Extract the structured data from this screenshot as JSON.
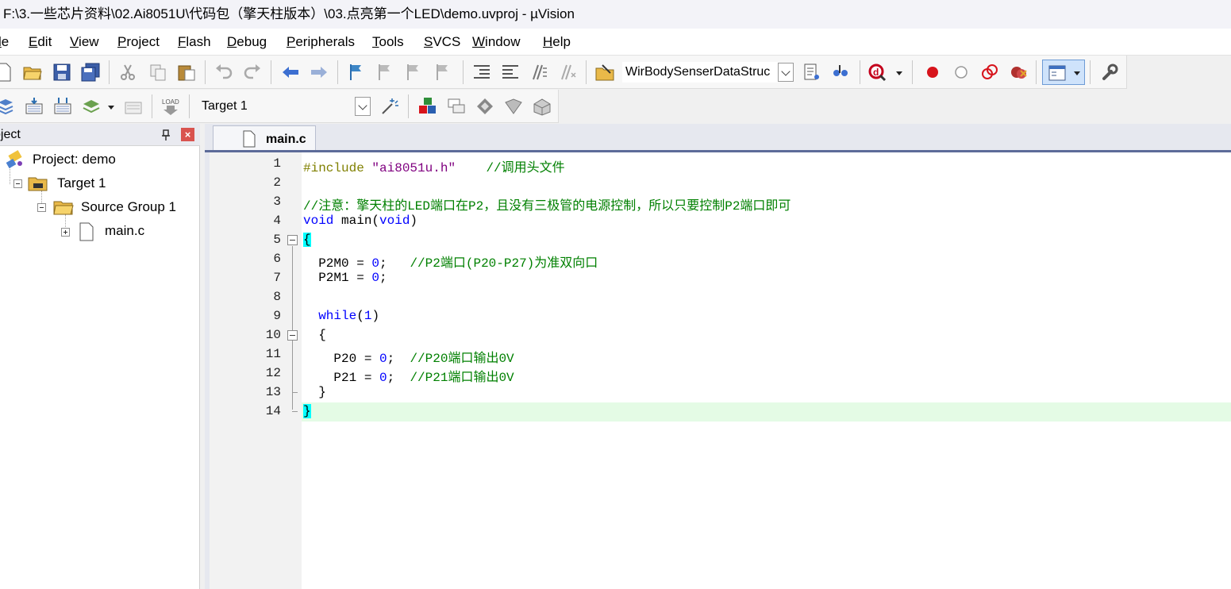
{
  "window": {
    "title": "F:\\3.一些芯片资料\\02.Ai8051U\\代码包（擎天柱版本）\\03.点亮第一个LED\\demo.uvproj - µVision"
  },
  "menu": {
    "file": "le",
    "edit": "Edit",
    "view": "View",
    "project": "Project",
    "flash": "Flash",
    "debug": "Debug",
    "peripherals": "Peripherals",
    "tools": "Tools",
    "svcs": "SVCS",
    "window": "Window",
    "help": "Help"
  },
  "toolbar": {
    "find_combo_value": "WirBodySenserDataStruc",
    "target_combo_value": "Target 1"
  },
  "project_panel": {
    "title": "oject",
    "tree": {
      "project": "Project: demo",
      "target": "Target 1",
      "group": "Source Group 1",
      "file": "main.c"
    }
  },
  "editor": {
    "tab_label": "main.c",
    "line_numbers": [
      "1",
      "2",
      "3",
      "4",
      "5",
      "6",
      "7",
      "8",
      "9",
      "10",
      "11",
      "12",
      "13",
      "14"
    ],
    "code": {
      "l1_pp": "#include",
      "l1_str": "\"ai8051u.h\"",
      "l1_cm": "//调用头文件",
      "l3_cm": "//注意：擎天柱的LED端口在P2，且没有三极管的电源控制，所以只要控制P2端口即可",
      "l4_kw1": "void",
      "l4_mid": " main(",
      "l4_kw2": "void",
      "l4_end": ")",
      "l5": "{",
      "l6_code": "  P2M0 = ",
      "l6_num": "0",
      "l6_semi": ";",
      "l6_cm": "//P2端口(P20-P27)为准双向口",
      "l7_code": "  P2M1 = ",
      "l7_num": "0",
      "l7_semi": ";",
      "l9_kw": "while",
      "l9_open": "(",
      "l9_num": "1",
      "l9_close": ")",
      "l10": "  {",
      "l11_code": "    P20 = ",
      "l11_num": "0",
      "l11_semi": ";",
      "l11_cm": "//P20端口输出0V",
      "l12_code": "    P21 = ",
      "l12_num": "0",
      "l12_semi": ";",
      "l12_cm": "//P21端口输出0V",
      "l13": "  }",
      "l14": "}"
    }
  },
  "icons": {
    "new": "new-file-icon",
    "open": "open-folder-icon",
    "save": "save-icon",
    "save_all": "save-all-icon",
    "cut": "cut-icon",
    "copy": "copy-icon",
    "paste": "paste-icon",
    "undo": "undo-icon",
    "redo": "redo-icon",
    "back": "nav-back-icon",
    "forward": "nav-forward-icon",
    "breakpoint": "breakpoint-icon"
  }
}
